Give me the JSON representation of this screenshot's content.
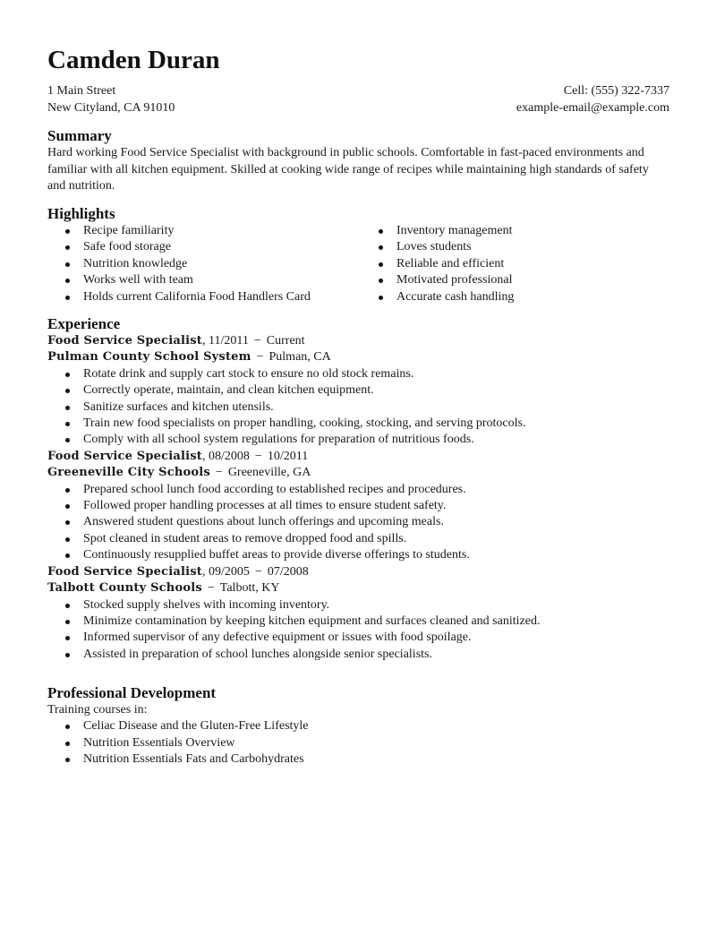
{
  "header": {
    "name": "Camden Duran",
    "address_line1": "1 Main Street",
    "address_line2": "New Cityland, CA 91010",
    "phone": "Cell: (555) 322-7337",
    "email": "example-email@example.com"
  },
  "summary": {
    "title": "Summary",
    "text": "Hard working Food Service Specialist with background in public schools. Comfortable in fast-paced environments and familiar with all kitchen equipment. Skilled at cooking wide range of recipes while maintaining high standards of safety and nutrition."
  },
  "highlights": {
    "title": "Highlights",
    "left": [
      "Recipe familiarity",
      "Safe food storage",
      "Nutrition knowledge",
      "Works well with team",
      "Holds current California Food Handlers Card"
    ],
    "right": [
      "Inventory management",
      "Loves students",
      "Reliable and efficient",
      "Motivated professional",
      "Accurate cash handling"
    ]
  },
  "experience": {
    "title": "Experience",
    "separator": "−",
    "jobs": [
      {
        "title": "Food Service Specialist",
        "start": "11/2011",
        "end": "Current",
        "employer": "Pulman County School System",
        "location": "Pulman, CA",
        "bullets": [
          "Rotate drink and supply cart stock to ensure no old stock remains.",
          "Correctly operate, maintain, and clean kitchen equipment.",
          "Sanitize surfaces and kitchen utensils.",
          "Train new food specialists on proper handling, cooking, stocking, and serving protocols.",
          "Comply with all school system regulations for preparation of nutritious foods."
        ]
      },
      {
        "title": "Food Service Specialist",
        "start": "08/2008",
        "end": "10/2011",
        "employer": "Greeneville City Schools",
        "location": "Greeneville, GA",
        "bullets": [
          "Prepared school lunch food according to established recipes and procedures.",
          "Followed proper handling processes at all times to ensure student safety.",
          "Answered student questions about lunch offerings and upcoming meals.",
          "Spot cleaned in student areas to remove dropped food and spills.",
          "Continuously resupplied buffet areas to provide diverse offerings to students."
        ]
      },
      {
        "title": "Food Service Specialist",
        "start": "09/2005",
        "end": "07/2008",
        "employer": "Talbott County Schools",
        "location": "Talbott, KY",
        "bullets": [
          "Stocked supply shelves with incoming inventory.",
          "Minimize contamination by keeping kitchen equipment and surfaces cleaned and sanitized.",
          "Informed supervisor of any defective equipment or issues with food spoilage.",
          "Assisted in preparation of school lunches alongside senior specialists."
        ]
      }
    ]
  },
  "professional_development": {
    "title": "Professional Development",
    "intro": "Training courses in:",
    "courses": [
      "Celiac Disease and the Gluten-Free Lifestyle",
      "Nutrition Essentials Overview",
      "Nutrition Essentials Fats and Carbohydrates"
    ]
  }
}
